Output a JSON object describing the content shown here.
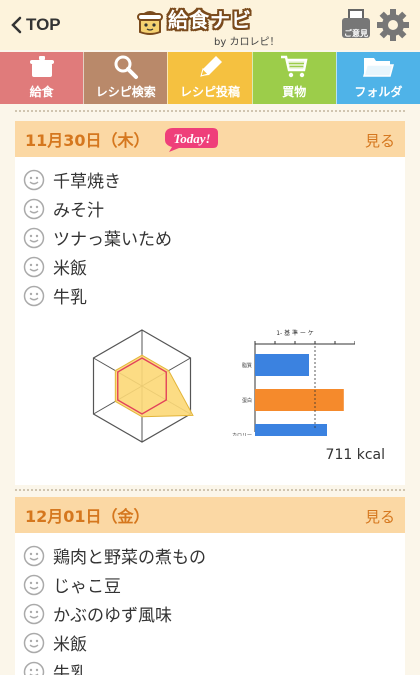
{
  "header": {
    "back_label": "TOP",
    "logo_title": "給食ナビ",
    "logo_sub": "by カロレピ！",
    "opinion_label": "ご意見"
  },
  "nav": [
    {
      "label": "給食",
      "color": "#e07b7b",
      "icon": "pot-icon"
    },
    {
      "label": "レシピ検索",
      "color": "#b9896a",
      "icon": "search-icon"
    },
    {
      "label": "レシピ投稿",
      "color": "#f5c140",
      "icon": "pencil-icon"
    },
    {
      "label": "買物",
      "color": "#9ccd4a",
      "icon": "cart-icon"
    },
    {
      "label": "フォルダ",
      "color": "#4fb3e8",
      "icon": "folder-icon"
    }
  ],
  "days": [
    {
      "date": "11月30日（木）",
      "badge": "Today!",
      "see_label": "見る",
      "dishes": [
        "千草焼き",
        "みそ汁",
        "ツナっ葉いため",
        "米飯",
        "牛乳"
      ],
      "kcal": "711 kcal",
      "bar_chart": {
        "title": "1- 基 準 ー ケ",
        "categories": [
          "脂質",
          "蛋白",
          "カロリー"
        ],
        "values": [
          0.9,
          1.48,
          1.2
        ],
        "colors": [
          "#3b82e0",
          "#f58a2c",
          "#3b82e0"
        ]
      },
      "radar": {
        "axes": 6,
        "values": [
          0.55,
          0.55,
          1.05,
          0.55,
          0.55,
          0.55
        ]
      }
    },
    {
      "date": "12月01日（金）",
      "see_label": "見る",
      "dishes": [
        "鶏肉と野菜の煮もの",
        "じゃこ豆",
        "かぶのゆず風味",
        "米飯",
        "牛乳"
      ]
    }
  ]
}
